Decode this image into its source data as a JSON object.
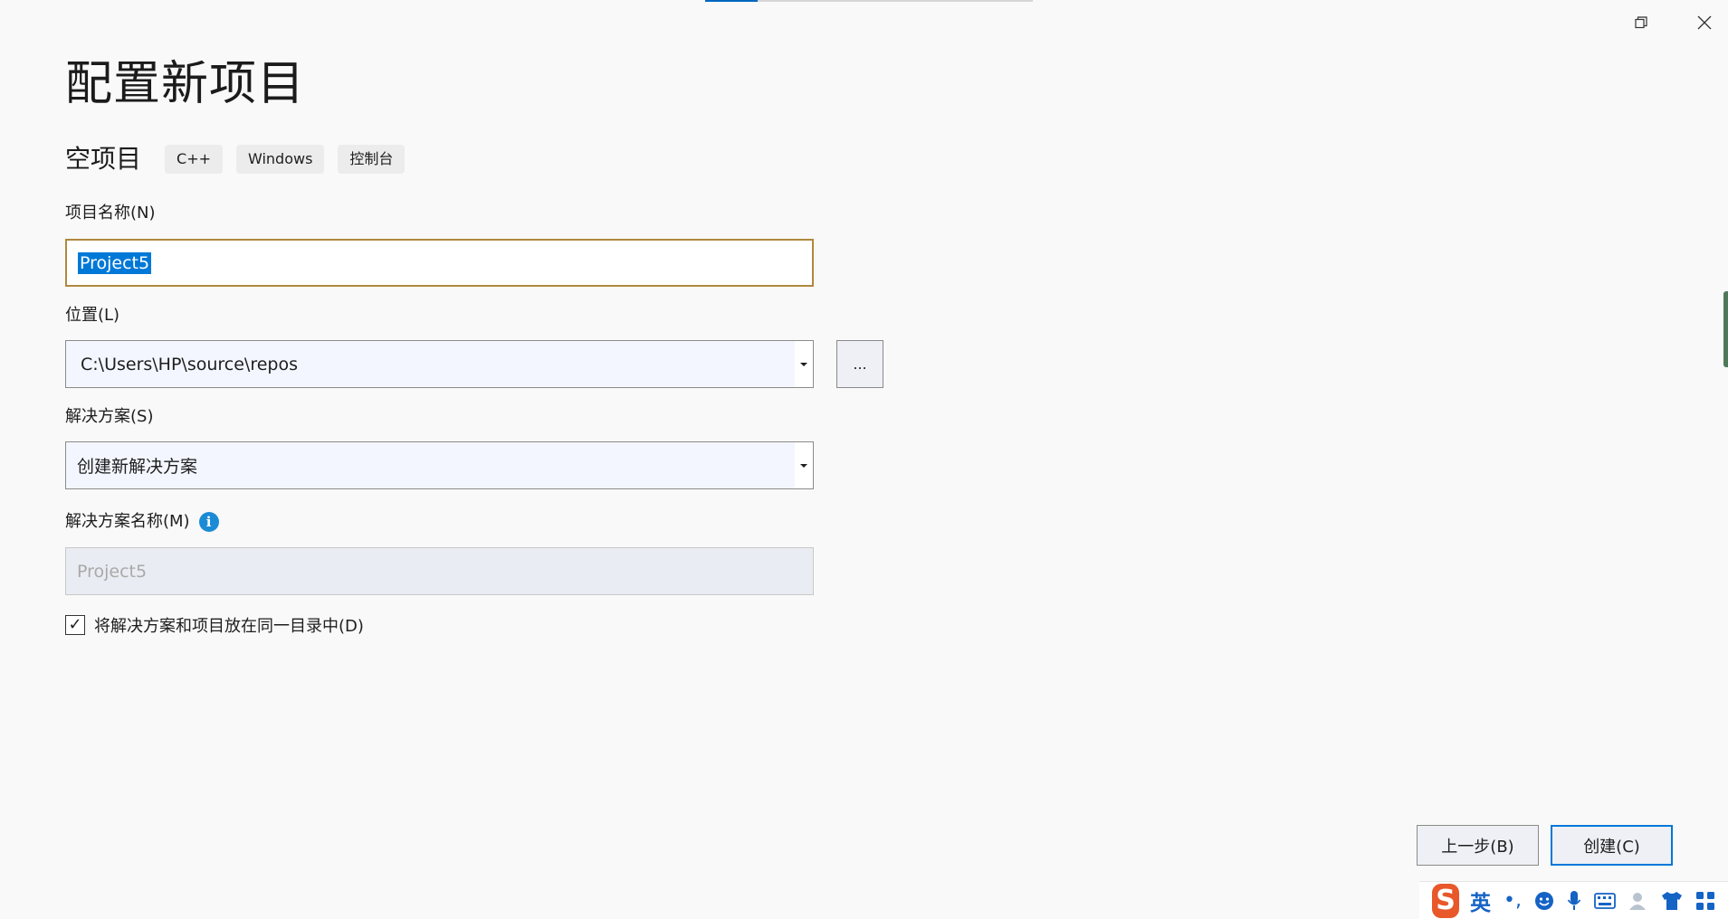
{
  "header": {
    "title": "配置新项目",
    "template_name": "空项目",
    "tags": [
      "C++",
      "Windows",
      "控制台"
    ],
    "progress_fraction": 0.16
  },
  "window_controls": {
    "restore_icon": "restore-icon",
    "close_icon": "close-icon"
  },
  "form": {
    "project_name": {
      "label": "项目名称(N)",
      "value": "Project5"
    },
    "location": {
      "label": "位置(L)",
      "value": "C:\\Users\\HP\\source\\repos",
      "browse_label": "..."
    },
    "solution": {
      "label": "解决方案(S)",
      "value": "创建新解决方案"
    },
    "solution_name": {
      "label": "解决方案名称(M)",
      "info_glyph": "i",
      "value": "Project5"
    },
    "same_directory": {
      "label": "将解决方案和项目放在同一目录中(D)",
      "checked": true,
      "check_glyph": "✓"
    }
  },
  "footer": {
    "back_label": "上一步(B)",
    "create_label": "创建(C)"
  },
  "ime_toolbar": {
    "logo": "S",
    "language": "英",
    "punctuation": "•,",
    "icons": [
      "emoji-icon",
      "microphone-icon",
      "keyboard-icon",
      "user-icon",
      "skin-icon",
      "grid-icon"
    ]
  },
  "colors": {
    "accent": "#0078d7",
    "focus_border": "#b0883d",
    "info": "#1c8bd6",
    "ime_brand": "#e8582a"
  }
}
